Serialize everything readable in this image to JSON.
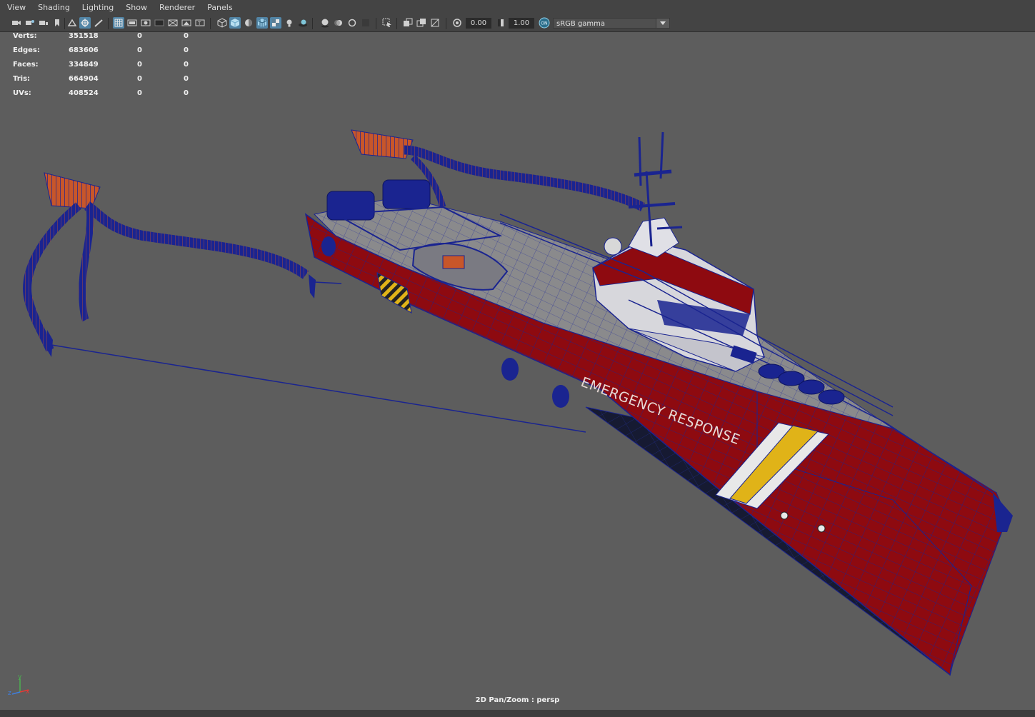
{
  "menu": [
    "View",
    "Shading",
    "Lighting",
    "Show",
    "Renderer",
    "Panels"
  ],
  "toolbar": {
    "exposure": "0.00",
    "gamma": "1.00",
    "color_space": "sRGB gamma",
    "on_badge": "ON",
    "icons": [
      "camera-icon",
      "camera-attributes-icon",
      "bookmark-icon",
      "image-plane-icon",
      "grid-icon",
      "film-gate-icon",
      "resolution-gate-icon",
      "gate-mask-icon",
      "field-chart-icon",
      "safe-action-icon",
      "safe-title-icon",
      "wireframe-icon",
      "smooth-shade-icon",
      "wireframe-on-shaded-icon",
      "textured-icon",
      "lights-icon",
      "shadows-icon",
      "xray-icon",
      "isolate-select-icon",
      "exposure-icon",
      "gamma-icon",
      "color-management-icon"
    ]
  },
  "hud": {
    "rows": [
      {
        "label": "Verts:",
        "v1": "351518",
        "v2": "0",
        "v3": "0"
      },
      {
        "label": "Edges:",
        "v1": "683606",
        "v2": "0",
        "v3": "0"
      },
      {
        "label": "Faces:",
        "v1": "334849",
        "v2": "0",
        "v3": "0"
      },
      {
        "label": "Tris:",
        "v1": "664904",
        "v2": "0",
        "v3": "0"
      },
      {
        "label": "UVs:",
        "v1": "408524",
        "v2": "0",
        "v3": "0"
      }
    ],
    "camera_status": "2D Pan/Zoom : persp",
    "axis_labels": {
      "y": "y",
      "x": "x",
      "z": "z"
    }
  },
  "model": {
    "hull_text": "EMERGENCY RESPONSE",
    "colors": {
      "hull": "#8e0a10",
      "wire": "#1a2490",
      "deck": "#8f8f8f",
      "superstructure": "#d7d7dc",
      "stripe_yellow": "#e0b318",
      "stripe_white": "#e8e8e8",
      "boom_orange": "#c8562a",
      "background": "#5d5d5d"
    }
  }
}
